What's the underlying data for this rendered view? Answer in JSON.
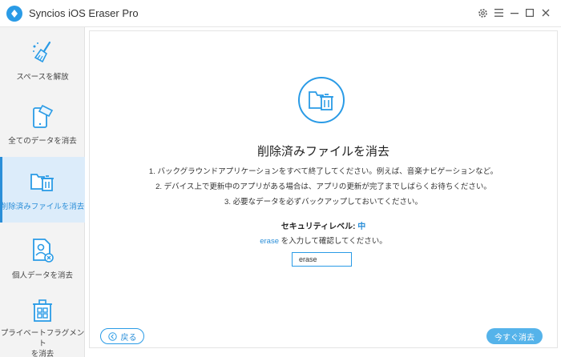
{
  "app": {
    "title": "Syncios iOS Eraser Pro"
  },
  "window_controls": [
    {
      "name": "settings-gear-icon",
      "glyph": "⚙"
    },
    {
      "name": "menu-icon",
      "glyph": "☰"
    },
    {
      "name": "minimize-icon",
      "glyph": "—"
    },
    {
      "name": "maximize-icon",
      "glyph": "☐"
    },
    {
      "name": "close-icon",
      "glyph": "✕"
    }
  ],
  "sidebar": {
    "items": [
      {
        "label": "スペースを解放",
        "icon": "broom-icon",
        "active": false
      },
      {
        "label": "全てのデータを消去",
        "icon": "phone-eraser-icon",
        "active": false
      },
      {
        "label": "削除済みファイルを消去",
        "icon": "folder-trash-icon",
        "active": true
      },
      {
        "label": "個人データを消去",
        "icon": "person-document-icon",
        "active": false
      },
      {
        "label": "プライベートフラグメントを消去",
        "label_line2": "を消去",
        "label_line1": "プライベートフラグメント",
        "icon": "fragment-trash-icon",
        "active": false
      }
    ]
  },
  "main": {
    "heading": "削除済みファイルを消去",
    "instructions": [
      "1. バックグラウンドアプリケーションをすべて終了してください。例えば、音楽ナビゲーションなど。",
      "2. デバイス上で更新中のアプリがある場合は、アプリの更新が完了までしばらくお待ちください。",
      "3. 必要なデータを必ずバックアップしておいてください。"
    ],
    "security_label": "セキュリティレベル: ",
    "security_value": "中",
    "confirm_keyword": "erase",
    "confirm_text": " を入力して確認してください。",
    "input_value": "erase"
  },
  "buttons": {
    "back": "戻る",
    "erase_now": "今すぐ消去"
  },
  "colors": {
    "accent": "#2a9be6",
    "active_bg": "#dcecfa",
    "erase_button": "#55b3ea"
  }
}
